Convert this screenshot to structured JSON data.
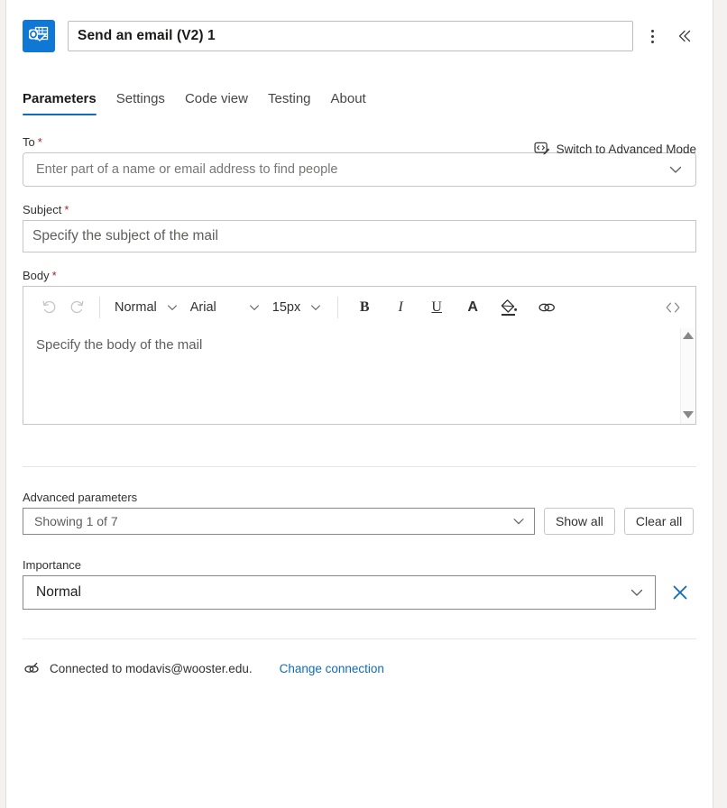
{
  "header": {
    "app_icon": "outlook-icon",
    "title_value": "Send an email (V2) 1",
    "menu_icon": "more-vertical-icon",
    "collapse_icon": "double-chevron-left-icon"
  },
  "tabs": [
    {
      "label": "Parameters",
      "active": true
    },
    {
      "label": "Settings",
      "active": false
    },
    {
      "label": "Code view",
      "active": false
    },
    {
      "label": "Testing",
      "active": false
    },
    {
      "label": "About",
      "active": false
    }
  ],
  "advanced_mode": {
    "label": "Switch to Advanced Mode",
    "icon": "code-edit-icon"
  },
  "fields": {
    "to": {
      "label": "To",
      "required_mark": "*",
      "placeholder": "Enter part of a name or email address to find people",
      "chevron_icon": "chevron-down-icon"
    },
    "subject": {
      "label": "Subject",
      "required_mark": "*",
      "placeholder": "Specify the subject of the mail"
    },
    "body": {
      "label": "Body",
      "required_mark": "*",
      "placeholder": "Specify the body of the mail"
    }
  },
  "toolbar": {
    "undo_icon": "undo-icon",
    "redo_icon": "redo-icon",
    "style_value": "Normal",
    "font_value": "Arial",
    "size_value": "15px",
    "bold_label": "B",
    "italic_label": "I",
    "underline_label": "U",
    "font_color_label": "A",
    "highlight_icon": "highlight-fill-icon",
    "link_icon": "link-icon",
    "code_view_icon": "code-brackets-icon",
    "chevron_icon": "chevron-down-icon"
  },
  "advanced_parameters": {
    "label": "Advanced parameters",
    "select_value": "Showing 1 of 7",
    "show_all_label": "Show all",
    "clear_all_label": "Clear all",
    "chevron_icon": "chevron-down-icon"
  },
  "importance": {
    "label": "Importance",
    "value": "Normal",
    "chevron_icon": "chevron-down-icon",
    "remove_icon": "close-x-icon"
  },
  "connection": {
    "icon": "plug-link-icon",
    "status_text": "Connected to modavis@wooster.edu.",
    "change_link": "Change connection"
  },
  "colors": {
    "accent": "#0f6cbd",
    "brand_icon_bg": "#0f78d4",
    "required": "#a4262c",
    "link": "#0f6cbd"
  }
}
